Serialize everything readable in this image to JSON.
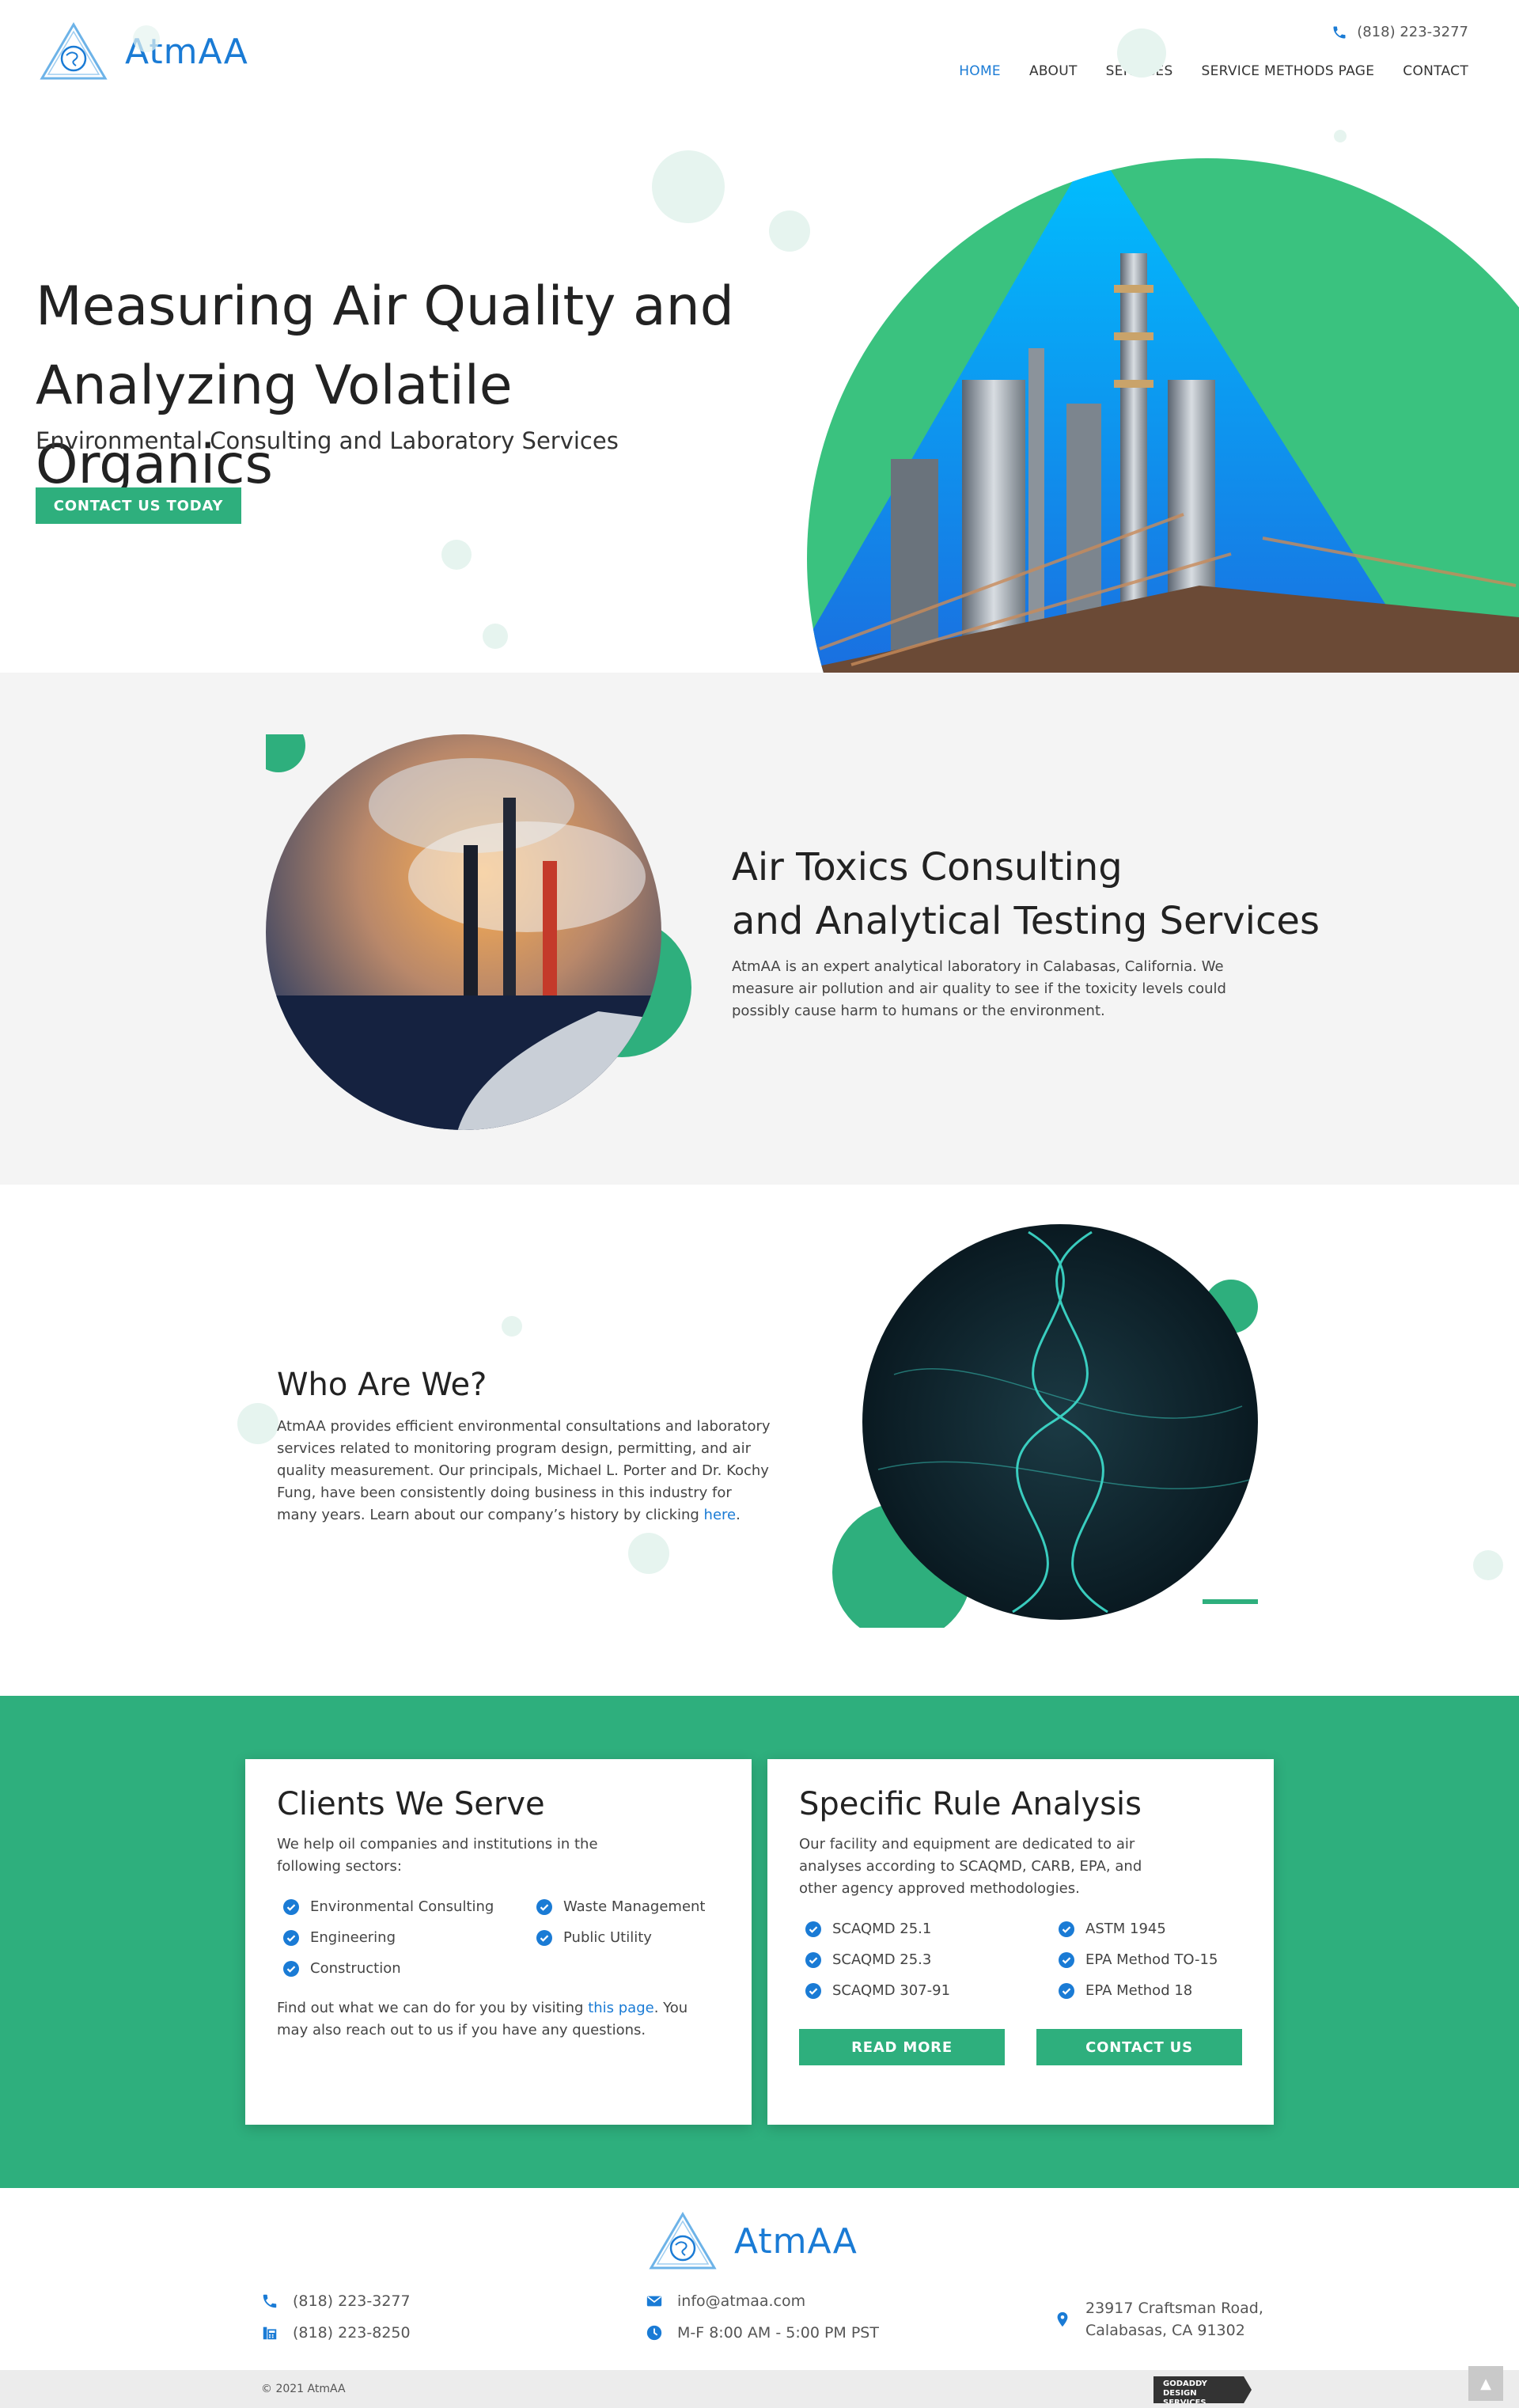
{
  "brand": {
    "name": "AtmAA",
    "blue": "#1a7bd5",
    "green": "#2eaf7d"
  },
  "header": {
    "phone": "(818) 223-3277",
    "nav": [
      "HOME",
      "ABOUT",
      "SERVICES",
      "SERVICE METHODS PAGE",
      "CONTACT"
    ],
    "active_nav": "HOME"
  },
  "hero": {
    "title_line1": "Measuring Air Quality and",
    "title_line2": "Analyzing Volatile Organics",
    "subtitle": "Environmental Consulting and Laboratory Services",
    "cta": "CONTACT US TODAY"
  },
  "consulting": {
    "title_line1": "Air Toxics Consulting",
    "title_line2": "and Analytical Testing Services",
    "body": "AtmAA is an expert analytical laboratory in Calabasas, California. We measure air pollution and air quality to see if the toxicity levels could possibly cause harm to humans or the environment."
  },
  "who": {
    "title": "Who Are We?",
    "body": "AtmAA provides efficient environmental consultations and laboratory services related to monitoring program design, permitting, and air quality measurement. Our principals, Michael L. Porter and Dr. Kochy Fung, have been consistently doing business in this industry for many years. Learn about our company’s history by clicking ",
    "link": "here",
    "end": "."
  },
  "clients": {
    "title": "Clients We Serve",
    "desc": "We help oil companies and institutions in the following sectors:",
    "items": [
      "Environmental Consulting",
      "Waste Management",
      "Engineering",
      "Public Utility",
      "Construction"
    ],
    "foot_pre": "Find out what we can do for you by visiting ",
    "foot_link": "this page",
    "foot_post": ". You may also reach out to us if you have any questions."
  },
  "rules": {
    "title": "Specific Rule Analysis",
    "desc": "Our facility and equipment are dedicated to air analyses according to SCAQMD, CARB, EPA, and other agency approved methodologies.",
    "items": [
      "SCAQMD 25.1",
      "ASTM 1945",
      "SCAQMD 25.3",
      "EPA Method TO-15",
      "SCAQMD 307-91",
      "EPA Method 18"
    ],
    "read_more": "READ MORE",
    "contact": "CONTACT US"
  },
  "footer": {
    "phone": "(818) 223-3277",
    "fax": "(818) 223-8250",
    "email": "info@atmaa.com",
    "hours": "M-F 8:00 AM - 5:00 PM PST",
    "address_line1": "23917 Craftsman Road,",
    "address_line2": "Calabasas, CA 91302",
    "copyright": "© 2021 AtmAA",
    "badge_line1": "GODADDY",
    "badge_line2": "DESIGN SERVICES"
  },
  "icons": [
    "atmaa-logo-icon",
    "phone-icon",
    "fax-icon",
    "email-icon",
    "clock-icon",
    "location-icon",
    "check-circle-icon",
    "scroll-top-icon"
  ]
}
